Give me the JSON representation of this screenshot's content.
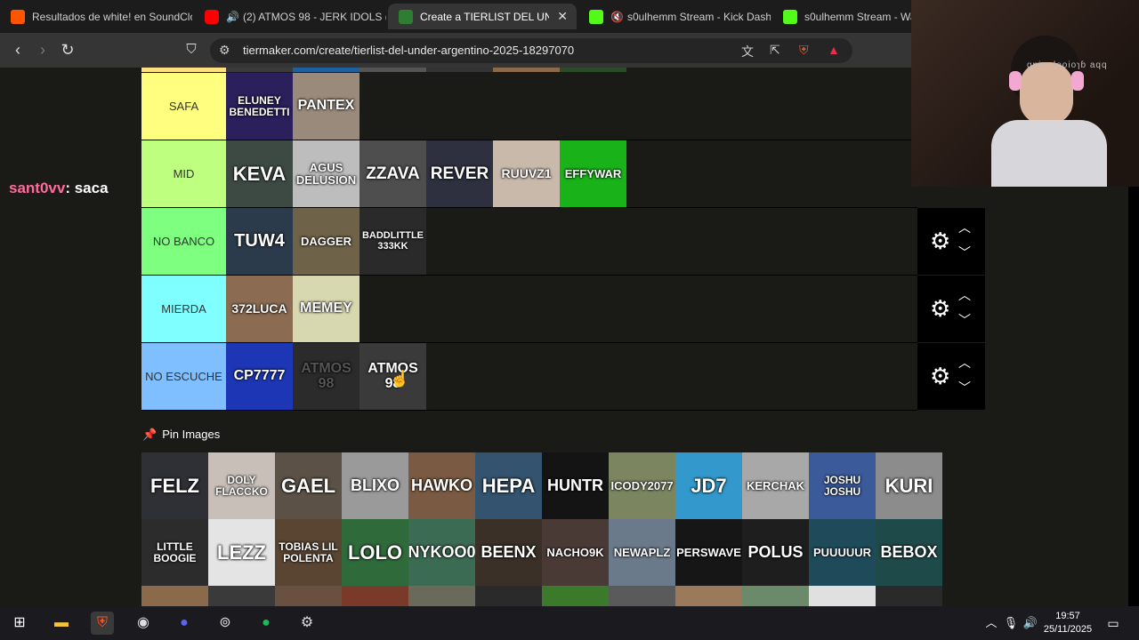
{
  "tabs": [
    {
      "title": "Resultados de white! en SoundClo",
      "color": "#ff5500"
    },
    {
      "title": "(2) ATMOS 98 - JERK IDOLS (FU",
      "color": "#ff0000"
    },
    {
      "title": "Create a TIERLIST DEL UNDER",
      "color": "#2e7d32"
    },
    {
      "title": "s0ulhemm Stream - Kick Dashb",
      "color": "#53fc18"
    },
    {
      "title": "s0ulhemm Stream - Wat",
      "color": "#53fc18"
    }
  ],
  "address": {
    "url": "tiermaker.com/create/tierlist-del-under-argentino-2025-18297070"
  },
  "chat": {
    "user": "sant0vv",
    "message": ": saca"
  },
  "tiers": [
    {
      "label": "SAFA",
      "color": "#fffe7f",
      "items": [
        {
          "name": "ELUNEY BENEDETTI",
          "bg": "#2b1f5c"
        },
        {
          "name": "PANTEX",
          "bg": "#9a8a7c"
        }
      ]
    },
    {
      "label": "MID",
      "color": "#bfff7f",
      "items": [
        {
          "name": "KEVA",
          "bg": "#3d4a44"
        },
        {
          "name": "AGUS DELUSION",
          "bg": "#bdbdbd"
        },
        {
          "name": "ZZAVA",
          "bg": "#4e4e4e"
        },
        {
          "name": "REVER",
          "bg": "#2e3040"
        },
        {
          "name": "RUUVZ1",
          "bg": "#c9b9aa"
        },
        {
          "name": "EFFYWAR",
          "bg": "#19b319"
        }
      ]
    },
    {
      "label": "NO BANCO",
      "color": "#7fff7f",
      "items": [
        {
          "name": "TUW4",
          "bg": "#2b3b4b"
        },
        {
          "name": "DAGGER",
          "bg": "#6e6248"
        },
        {
          "name": "BADDLITTLE 333KK",
          "bg": "#2a2a2a"
        }
      ]
    },
    {
      "label": "MIERDA",
      "color": "#7fffff",
      "items": [
        {
          "name": "372LUCA",
          "bg": "#8b6b52"
        },
        {
          "name": "MEMEY",
          "bg": "#d8d8b0"
        }
      ]
    },
    {
      "label": "NO ESCUCHE",
      "color": "#7fbfff",
      "items": [
        {
          "name": "CP7777",
          "bg": "#1d36b5"
        },
        {
          "name": "ATMOS 98",
          "bg": "#2b2b2b"
        },
        {
          "name": "ATMOS 98",
          "bg": "#3a3a3a"
        }
      ]
    }
  ],
  "pin": {
    "label": "Pin Images"
  },
  "pool": [
    {
      "name": "FELZ",
      "bg": "#2f2f36"
    },
    {
      "name": "DOLY FLACCKO",
      "bg": "#c8c0b8"
    },
    {
      "name": "GAEL",
      "bg": "#5b5146"
    },
    {
      "name": "BLIXO",
      "bg": "#9a9a9a"
    },
    {
      "name": "HAWKO",
      "bg": "#7a5a42"
    },
    {
      "name": "HEPA",
      "bg": "#33536e"
    },
    {
      "name": "HUNTR",
      "bg": "#141414"
    },
    {
      "name": "ICODY2077",
      "bg": "#7b8560"
    },
    {
      "name": "JD7",
      "bg": "#3399cc"
    },
    {
      "name": "KERCHAK",
      "bg": "#a8a8a8"
    },
    {
      "name": "JOSHU JOSHU",
      "bg": "#3a5a9a"
    },
    {
      "name": "KURI",
      "bg": "#8c8c8c"
    },
    {
      "name": "LITTLE BOOGIE",
      "bg": "#2c2c2c"
    },
    {
      "name": "LEZZ",
      "bg": "#e4e4e4"
    },
    {
      "name": "TOBIAS LIL POLENTA",
      "bg": "#5a4532"
    },
    {
      "name": "LOLO",
      "bg": "#2f6a3a"
    },
    {
      "name": "NYKOO0",
      "bg": "#3b6b52"
    },
    {
      "name": "BEENX",
      "bg": "#3a3028"
    },
    {
      "name": "NACHO9K",
      "bg": "#4a3a36"
    },
    {
      "name": "NEWAPLZ",
      "bg": "#6a7a8a"
    },
    {
      "name": "PERSWAVE",
      "bg": "#161616"
    },
    {
      "name": "POLUS",
      "bg": "#1e1e1e"
    },
    {
      "name": "PUUUUUR",
      "bg": "#1f4a5a"
    },
    {
      "name": "BEBOX",
      "bg": "#1f4a4a"
    },
    {
      "name": "",
      "bg": "#8a6a4a"
    },
    {
      "name": "",
      "bg": "#3a3a3a"
    },
    {
      "name": "",
      "bg": "#6a5040"
    },
    {
      "name": "",
      "bg": "#7a3a2a"
    },
    {
      "name": "",
      "bg": "#6a6a5a"
    },
    {
      "name": "",
      "bg": "#2a2a2a"
    },
    {
      "name": "",
      "bg": "#3a7a2a"
    },
    {
      "name": "",
      "bg": "#5a5a5a"
    },
    {
      "name": "",
      "bg": "#9a7a5a"
    },
    {
      "name": "",
      "bg": "#6a8a6a"
    },
    {
      "name": "",
      "bg": "#e0e0e0"
    },
    {
      "name": "",
      "bg": "#2a2a2a"
    }
  ],
  "cam": {
    "overlay": "gnia deoioɿɓ aqq"
  },
  "clock": {
    "time": "19:57",
    "date": "25/11/2025"
  }
}
